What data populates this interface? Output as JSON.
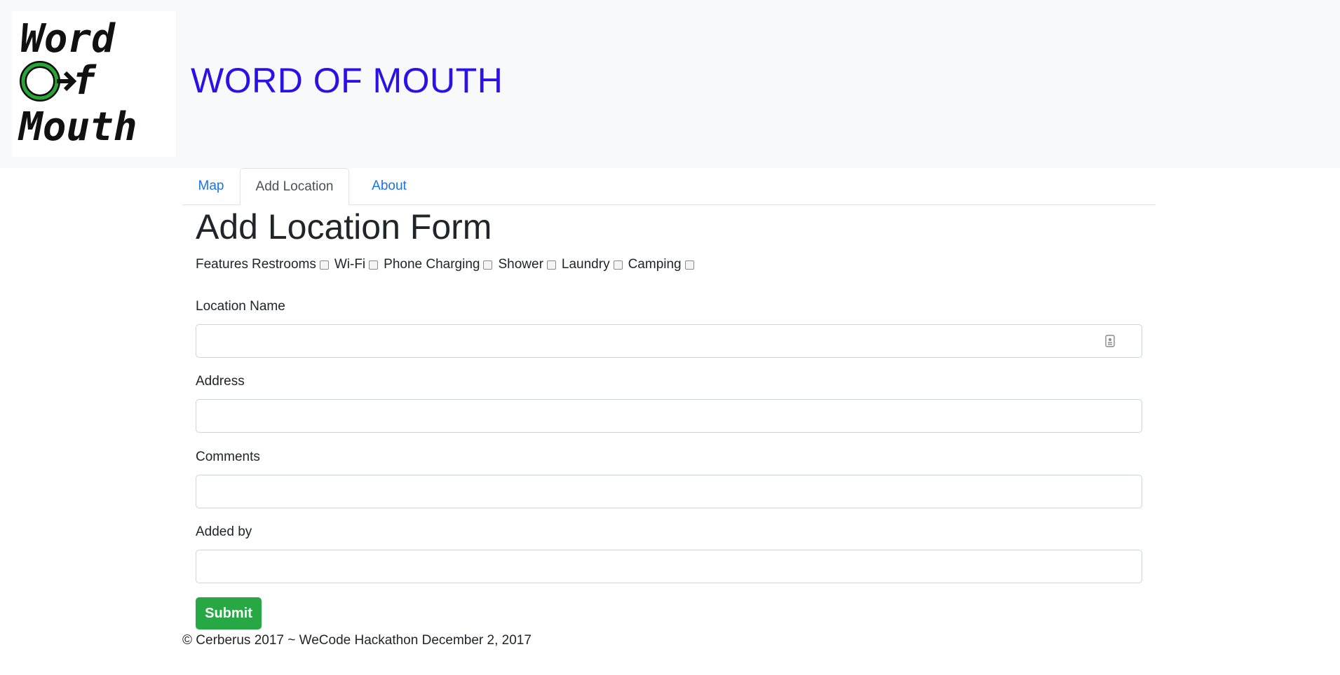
{
  "header": {
    "logo_lines": [
      "Word",
      "Of",
      "Mouth"
    ],
    "title": "WORD OF MOUTH",
    "title_color": "#2a11e6"
  },
  "tabs": [
    {
      "label": "Map",
      "active": false
    },
    {
      "label": "Add Location",
      "active": true
    },
    {
      "label": "About",
      "active": false
    }
  ],
  "form": {
    "title": "Add Location Form",
    "features_label": "Features",
    "features": [
      {
        "label": "Restrooms",
        "checked": false
      },
      {
        "label": "Wi-Fi",
        "checked": false
      },
      {
        "label": "Phone Charging",
        "checked": false
      },
      {
        "label": "Shower",
        "checked": false
      },
      {
        "label": "Laundry",
        "checked": false
      },
      {
        "label": "Camping",
        "checked": false
      }
    ],
    "fields": [
      {
        "label": "Location Name",
        "value": "",
        "placeholder": ""
      },
      {
        "label": "Address",
        "value": "",
        "placeholder": ""
      },
      {
        "label": "Comments",
        "value": "",
        "placeholder": ""
      },
      {
        "label": "Added by",
        "value": "",
        "placeholder": ""
      }
    ],
    "submit_label": "Submit",
    "submit_color": "#28a745"
  },
  "footer": {
    "text": "© Cerberus 2017 ~ WeCode Hackathon December 2, 2017"
  },
  "icons": {
    "location_name_field": "contact-card-icon"
  }
}
